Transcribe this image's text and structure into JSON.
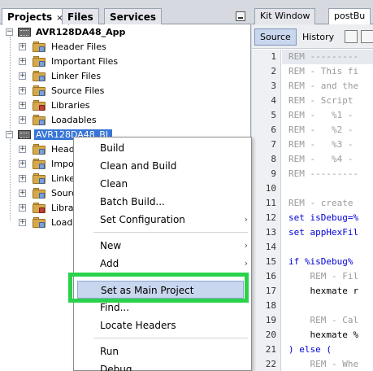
{
  "left_panel": {
    "tabs": [
      {
        "label": "Projects",
        "close": "×"
      },
      {
        "label": "Files"
      },
      {
        "label": "Services"
      }
    ],
    "tree": {
      "project1": {
        "name": "AVR128DA48_App",
        "folders": [
          "Header Files",
          "Important Files",
          "Linker Files",
          "Source Files",
          "Libraries",
          "Loadables"
        ]
      },
      "project2": {
        "name": "AVR128DA48_BL",
        "folders": [
          "Head",
          "Impor",
          "Linker",
          "Sourc",
          "Librar",
          "Loada"
        ]
      }
    }
  },
  "right_panel": {
    "tabs": [
      {
        "label": "Kit Window"
      },
      {
        "label": "postBu"
      }
    ],
    "toolbar": {
      "source_label": "Source",
      "history_label": "History"
    },
    "line_numbers": [
      "1",
      "2",
      "3",
      "4",
      "5",
      "6",
      "7",
      "8",
      "9",
      "10",
      "11",
      "12",
      "13",
      "14",
      "15",
      "16",
      "17",
      "18",
      "19",
      "20",
      "21",
      "22"
    ],
    "code_lines": [
      "REM ---------",
      "REM - This fi",
      "REM - and the",
      "REM - Script",
      "REM -   %1 -",
      "REM -   %2 -",
      "REM -   %3 -",
      "REM -   %4 -",
      "REM ---------",
      "",
      "REM - create",
      "set isDebug=%",
      "set appHexFil",
      "",
      "if %isDebug%",
      "    REM - Fil",
      "    hexmate r",
      "",
      "    REM - Cal",
      "    hexmate %",
      ") else (",
      "    REM - Whe"
    ]
  },
  "context_menu": {
    "items": [
      {
        "label": "Build"
      },
      {
        "label": "Clean and Build"
      },
      {
        "label": "Clean"
      },
      {
        "label": "Batch Build..."
      },
      {
        "label": "Set Configuration",
        "submenu": true
      },
      {
        "label": "New",
        "submenu": true
      },
      {
        "label": "Add",
        "submenu": true
      },
      {
        "label": "Set as Main Project",
        "selected": true
      },
      {
        "label": "Find..."
      },
      {
        "label": "Locate Headers"
      },
      {
        "label": "Run"
      },
      {
        "label": "Debug"
      }
    ],
    "submenu_arrow": "›"
  },
  "colors": {
    "highlight_box": "#2ad24b",
    "selection": "#3875d7",
    "keyword": "#0000d6",
    "comment": "#9a9a9a"
  },
  "icons": [
    "close-icon",
    "minimize-icon",
    "project-icon",
    "folder-icon",
    "expand-icon",
    "submenu-arrow-icon"
  ]
}
